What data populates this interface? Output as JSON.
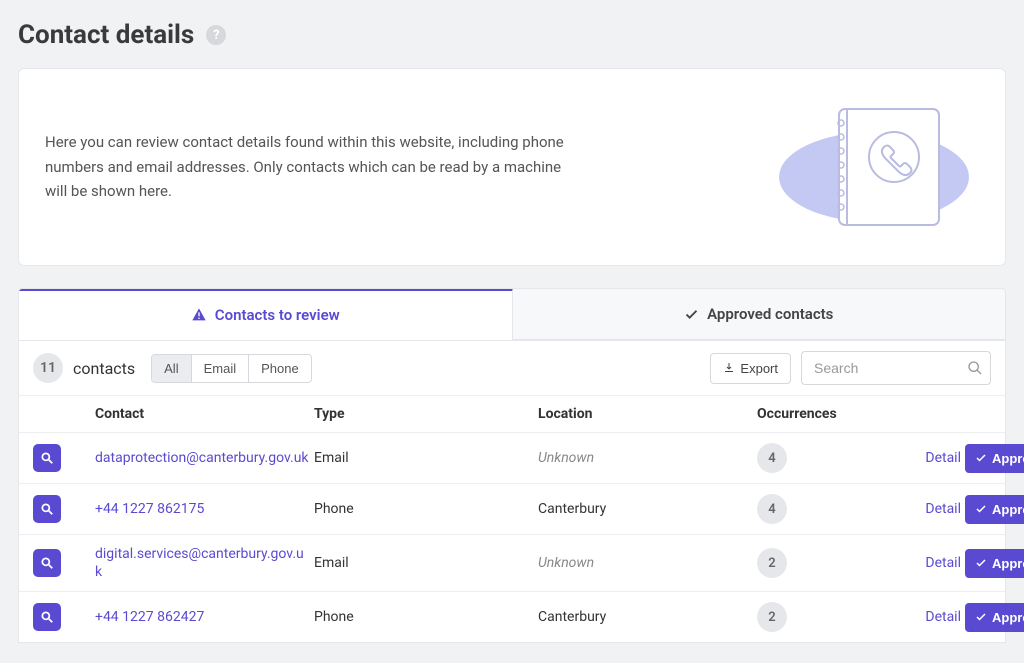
{
  "page": {
    "title": "Contact details",
    "intro": "Here you can review contact details found within this website, including phone numbers and email addresses. Only contacts which can be read by a machine will be shown here."
  },
  "tabs": {
    "review": "Contacts to review",
    "approved": "Approved contacts"
  },
  "filters": {
    "count": "11",
    "label": "contacts",
    "all": "All",
    "email": "Email",
    "phone": "Phone",
    "export": "Export",
    "search_placeholder": "Search"
  },
  "columns": {
    "contact": "Contact",
    "type": "Type",
    "location": "Location",
    "occurrences": "Occurrences"
  },
  "actions": {
    "detail": "Detail",
    "approve": "Approve"
  },
  "rows": [
    {
      "contact": "dataprotection@canterbury.gov.uk",
      "type": "Email",
      "location": "Unknown",
      "location_unknown": true,
      "occurrences": "4"
    },
    {
      "contact": "+44 1227 862175",
      "type": "Phone",
      "location": "Canterbury",
      "location_unknown": false,
      "occurrences": "4"
    },
    {
      "contact": "digital.services@canterbury.gov.uk",
      "type": "Email",
      "location": "Unknown",
      "location_unknown": true,
      "occurrences": "2"
    },
    {
      "contact": "+44 1227 862427",
      "type": "Phone",
      "location": "Canterbury",
      "location_unknown": false,
      "occurrences": "2"
    }
  ]
}
